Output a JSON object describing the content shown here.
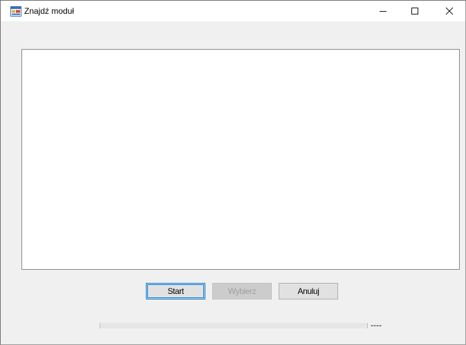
{
  "window": {
    "title": "Znajdź moduł",
    "icon": "application-window-icon",
    "controls": {
      "minimize": "minimize-icon",
      "maximize": "maximize-icon",
      "close": "close-icon"
    }
  },
  "list": {
    "items": []
  },
  "buttons": {
    "start_label": "Start",
    "choose_label": "Wybierz",
    "choose_enabled": false,
    "cancel_label": "Anuluj"
  },
  "progress": {
    "value": 0,
    "status_text": "----"
  },
  "colors": {
    "accent": "#0078d7",
    "window_bg": "#f0f0f0",
    "disabled_text": "#a0a0a0"
  }
}
